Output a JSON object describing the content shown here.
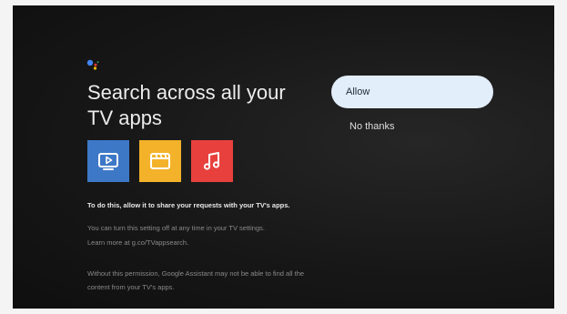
{
  "title": "Search across all your TV apps",
  "tiles": [
    {
      "icon": "tv-play-icon",
      "color": "#3d78c6"
    },
    {
      "icon": "clapperboard-icon",
      "color": "#f3b22a"
    },
    {
      "icon": "music-note-icon",
      "color": "#e8413d"
    }
  ],
  "description": {
    "primary": "To do this, allow it to share your requests with your TV's apps.",
    "settings_note": "You can turn this setting off at any time in your TV settings.",
    "learn_more": "Learn more at g.co/TVappsearch.",
    "permission_note": "Without this permission, Google Assistant may not be able to find all the content from your TV's apps."
  },
  "actions": {
    "allow_label": "Allow",
    "no_thanks_label": "No thanks"
  }
}
